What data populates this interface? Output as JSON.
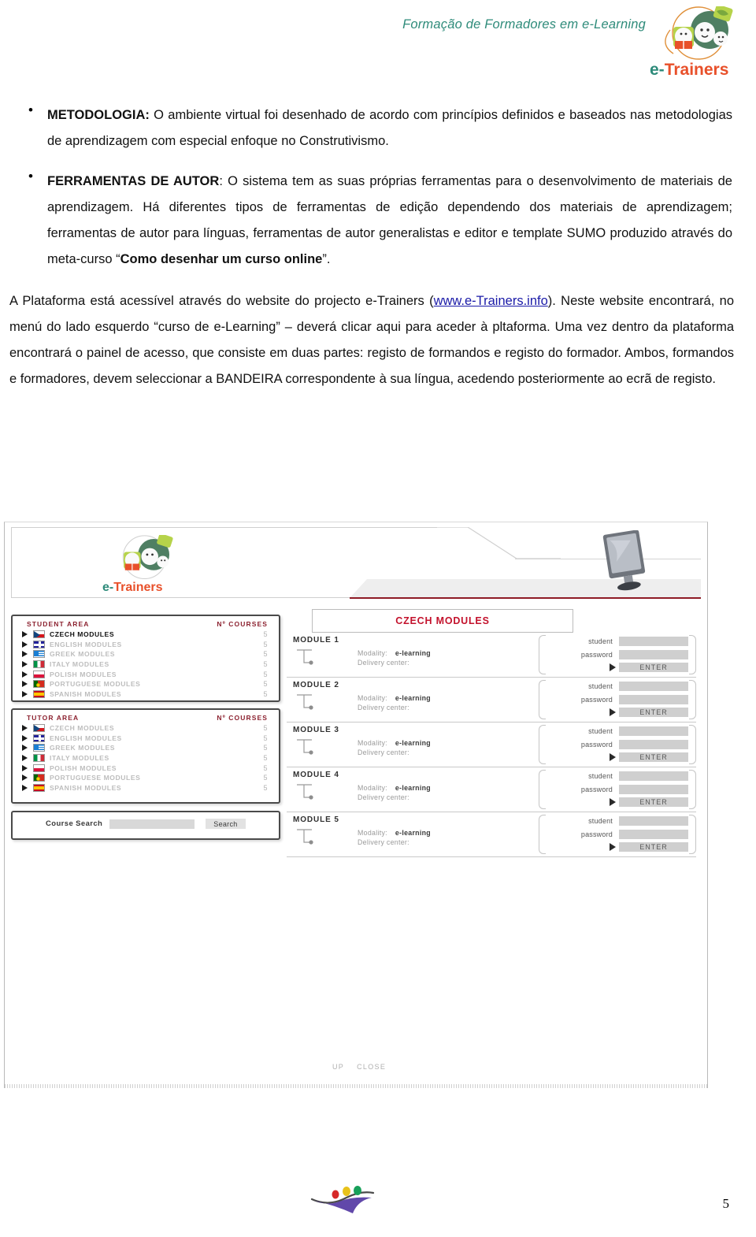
{
  "header": {
    "tagline": "Formação de Formadores em e-Learning",
    "logo_prefix": "e-",
    "logo_suffix": "Trainers",
    "brand_teal": "#2e8b7a",
    "brand_orange": "#e8502a"
  },
  "body": {
    "bullets": [
      {
        "lead": "METODOLOGIA:",
        "text": " O ambiente virtual foi desenhado de acordo com princípios definidos e baseados nas metodologias de aprendizagem com especial enfoque no Construtivismo."
      },
      {
        "lead": "FERRAMENTAS DE AUTOR",
        "text": ": O sistema tem as suas próprias ferramentas para o desenvolvimento de materiais de aprendizagem. Há diferentes tipos de ferramentas de edição dependendo dos materiais de aprendizagem; ferramentas de autor para línguas, ferramentas de autor generalistas e editor e template SUMO produzido através do meta-curso “",
        "bold_tail": "Como desenhar um curso online",
        "tail": "”."
      }
    ],
    "paragraph": {
      "part1": "A Plataforma está acessível através do website do projecto e-Trainers (",
      "link": "www.e-Trainers.info",
      "part2": "). Neste website encontrará, no menú do lado esquerdo “curso de e-Learning” – deverá clicar aqui para aceder à pltaforma. Uma vez dentro da plataforma encontrará o painel de acesso, que consiste em duas partes: registo de formandos e registo do formador. Ambos, formandos e formadores, devem seleccionar a BANDEIRA correspondente à sua língua, acedendo posteriormente ao ecrã de registo."
    }
  },
  "screenshot": {
    "banner": {
      "logo_prefix": "e-",
      "logo_suffix": "Trainers"
    },
    "student_panel": {
      "title": "STUDENT AREA",
      "count_header": "Nº COURSES",
      "items": [
        {
          "label": "CZECH MODULES",
          "count": "5",
          "flag": "f-cz",
          "active": true
        },
        {
          "label": "ENGLISH MODULES",
          "count": "5",
          "flag": "f-en",
          "active": false
        },
        {
          "label": "GREEK MODULES",
          "count": "5",
          "flag": "f-gr",
          "active": false
        },
        {
          "label": "ITALY MODULES",
          "count": "5",
          "flag": "f-it",
          "active": false
        },
        {
          "label": "POLISH MODULES",
          "count": "5",
          "flag": "f-pl",
          "active": false
        },
        {
          "label": "PORTUGUESE MODULES",
          "count": "5",
          "flag": "f-pt",
          "active": false
        },
        {
          "label": "SPANISH MODULES",
          "count": "5",
          "flag": "f-es",
          "active": false
        }
      ]
    },
    "tutor_panel": {
      "title": "TUTOR AREA",
      "count_header": "Nº COURSES",
      "items": [
        {
          "label": "CZECH MODULES",
          "count": "5",
          "flag": "f-cz",
          "active": false
        },
        {
          "label": "ENGLISH MODULES",
          "count": "5",
          "flag": "f-en",
          "active": false
        },
        {
          "label": "GREEK MODULES",
          "count": "5",
          "flag": "f-gr",
          "active": false
        },
        {
          "label": "ITALY MODULES",
          "count": "5",
          "flag": "f-it",
          "active": false
        },
        {
          "label": "POLISH MODULES",
          "count": "5",
          "flag": "f-pl",
          "active": false
        },
        {
          "label": "PORTUGUESE MODULES",
          "count": "5",
          "flag": "f-pt",
          "active": false
        },
        {
          "label": "SPANISH MODULES",
          "count": "5",
          "flag": "f-es",
          "active": false
        }
      ]
    },
    "search": {
      "label": "Course Search",
      "value": "",
      "button": "Search"
    },
    "modules_panel": {
      "title": "CZECH MODULES",
      "title_color": "#c3122c",
      "modality_label": "Modality:",
      "modality_value": "e-learning",
      "delivery_label": "Delivery center:",
      "delivery_value": "",
      "student_label": "student",
      "password_label": "password",
      "enter_label": "ENTER",
      "modules": [
        {
          "name": "MODULE 1"
        },
        {
          "name": "MODULE 2"
        },
        {
          "name": "MODULE 3"
        },
        {
          "name": "MODULE 4"
        },
        {
          "name": "MODULE 5"
        }
      ]
    },
    "footer_links": {
      "up": "UP",
      "close": "CLOSE"
    }
  },
  "footer": {
    "page_number": "5"
  }
}
